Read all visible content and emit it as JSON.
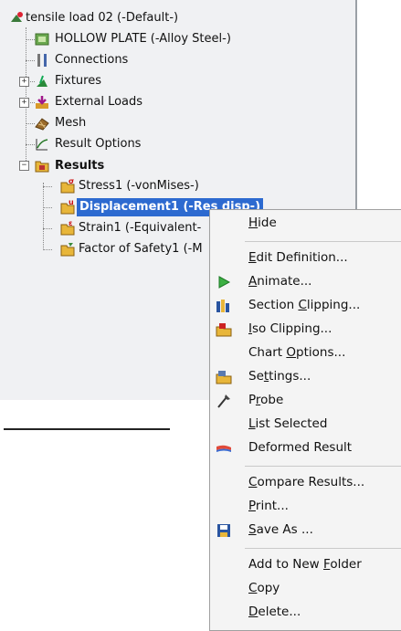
{
  "tree": {
    "root": "tensile load 02 (-Default-)",
    "items": [
      {
        "label": "HOLLOW PLATE (-Alloy Steel-)",
        "icon": "part-icon"
      },
      {
        "label": "Connections",
        "icon": "connections-icon"
      },
      {
        "label": "Fixtures",
        "icon": "fixtures-icon",
        "expander": "+"
      },
      {
        "label": "External Loads",
        "icon": "external-loads-icon",
        "expander": "+"
      },
      {
        "label": "Mesh",
        "icon": "mesh-icon"
      },
      {
        "label": "Result Options",
        "icon": "result-options-icon"
      },
      {
        "label": "Results",
        "icon": "results-folder-icon",
        "expander": "−"
      }
    ],
    "results": [
      {
        "label": "Stress1 (-vonMises-)",
        "icon": "stress-plot-icon"
      },
      {
        "label": "Displacement1 (-Res disp-)",
        "icon": "displacement-plot-icon",
        "selected": true
      },
      {
        "label": "Strain1 (-Equivalent-",
        "icon": "strain-plot-icon"
      },
      {
        "label": "Factor of Safety1 (-M",
        "icon": "fos-plot-icon"
      }
    ]
  },
  "menu": {
    "hide": {
      "pre": "",
      "u": "H",
      "post": "ide"
    },
    "edit_definition": {
      "pre": "",
      "u": "E",
      "post": "dit Definition..."
    },
    "animate": {
      "pre": "",
      "u": "A",
      "post": "nimate..."
    },
    "section_clipping": {
      "pre": "Section ",
      "u": "C",
      "post": "lipping..."
    },
    "iso_clipping": {
      "pre": "",
      "u": "I",
      "post": "so Clipping..."
    },
    "chart_options": {
      "pre": "Chart ",
      "u": "O",
      "post": "ptions..."
    },
    "settings": {
      "pre": "Se",
      "u": "t",
      "post": "tings..."
    },
    "probe": {
      "pre": "P",
      "u": "r",
      "post": "obe"
    },
    "list_selected": {
      "pre": "",
      "u": "L",
      "post": "ist Selected"
    },
    "deformed_result": {
      "pre": "Deformed Result",
      "u": "",
      "post": ""
    },
    "compare_results": {
      "pre": "",
      "u": "C",
      "post": "ompare Results..."
    },
    "print": {
      "pre": "",
      "u": "P",
      "post": "rint..."
    },
    "save_as": {
      "pre": "",
      "u": "S",
      "post": "ave As ..."
    },
    "add_to_new_folder": {
      "pre": "Add to New ",
      "u": "F",
      "post": "older"
    },
    "copy": {
      "pre": "",
      "u": "C",
      "post": "opy"
    },
    "delete": {
      "pre": "",
      "u": "D",
      "post": "elete..."
    }
  },
  "colors": {
    "selection": "#2d6ad0",
    "menu_bg": "#f4f4f4",
    "tree_bg": "#f0f1f3"
  }
}
